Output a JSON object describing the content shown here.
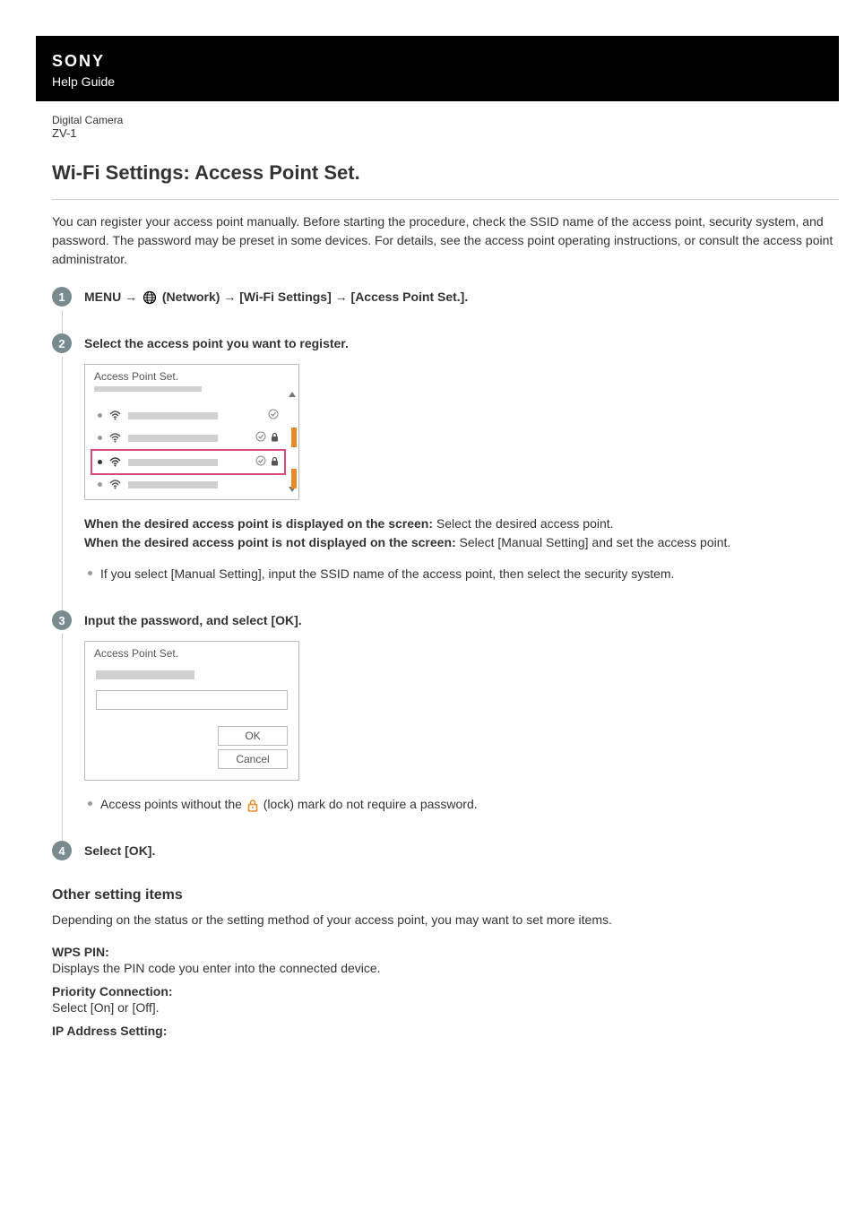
{
  "header": {
    "brand": "SONY",
    "subtitle": "Help Guide"
  },
  "product": {
    "category": "Digital Camera",
    "model": "ZV-1"
  },
  "page": {
    "title": "Wi-Fi Settings: Access Point Set.",
    "intro": "You can register your access point manually. Before starting the procedure, check the SSID name of the access point, security system, and password. The password may be preset in some devices. For details, see the access point operating instructions, or consult the access point administrator."
  },
  "steps": {
    "s1": {
      "num": "1",
      "prefix": "MENU → ",
      "network": " (Network) → [Wi-Fi Settings] → [Access Point Set.]."
    },
    "s2": {
      "num": "2",
      "title": "Select the access point you want to register.",
      "screenshot_title": "Access Point Set.",
      "displayed_label": "When the desired access point is displayed on the screen:",
      "displayed_text": " Select the desired access point.",
      "not_displayed_label": "When the desired access point is not displayed on the screen:",
      "not_displayed_text": " Select [Manual Setting] and set the access point.",
      "bullet": "If you select [Manual Setting], input the SSID name of the access point, then select the security system."
    },
    "s3": {
      "num": "3",
      "title": "Input the password, and select [OK].",
      "screenshot_title": "Access Point Set.",
      "ok_label": "OK",
      "cancel_label": "Cancel",
      "bullet_pre": "Access points without the ",
      "bullet_post": " (lock) mark do not require a password."
    },
    "s4": {
      "num": "4",
      "title": "Select [OK]."
    }
  },
  "other": {
    "heading": "Other setting items",
    "intro": "Depending on the status or the setting method of your access point, you may want to set more items.",
    "items": [
      {
        "label": "WPS PIN:",
        "desc": "Displays the PIN code you enter into the connected device."
      },
      {
        "label": "Priority Connection:",
        "desc": "Select [On] or [Off]."
      },
      {
        "label": "IP Address Setting:",
        "desc": ""
      }
    ]
  }
}
